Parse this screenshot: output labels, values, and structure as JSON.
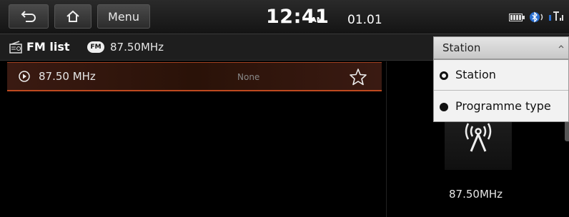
{
  "status_bar": {
    "menu_label": "Menu",
    "time": "12:41",
    "ampm": "AM",
    "date": "01.01",
    "icons": [
      "back-icon",
      "home-icon",
      "battery-icon",
      "bluetooth-icon",
      "signal-icon"
    ]
  },
  "header": {
    "title": "FM list",
    "band_badge": "FM",
    "frequency": "87.50MHz",
    "icon": "radio-icon"
  },
  "stations": [
    {
      "frequency": "87.50 MHz",
      "programme_type": "None",
      "favorite": false
    }
  ],
  "side_panel": {
    "frequency": "87.50MHz",
    "icon": "broadcast-antenna-icon"
  },
  "sort_dropdown": {
    "selected": "Station",
    "expanded": true,
    "options": [
      {
        "label": "Station",
        "checked": true
      },
      {
        "label": "Programme type",
        "checked": false
      }
    ]
  },
  "colors": {
    "highlight_border": "#c04a20",
    "highlight_bg": "#2a1208",
    "background": "#000000"
  }
}
